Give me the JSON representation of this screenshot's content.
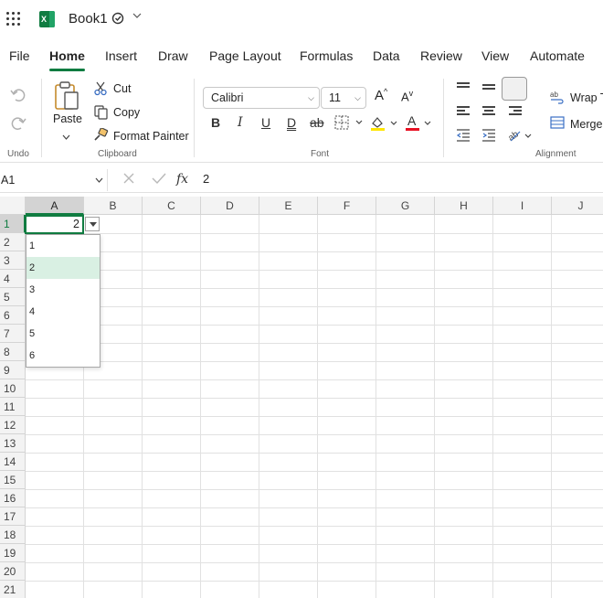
{
  "titlebar": {
    "app_logo": "X",
    "doc_title": "Book1",
    "saved_icon": "cloud-check-icon",
    "chevron_icon": "chevron-down-icon"
  },
  "tabs": [
    {
      "label": "File"
    },
    {
      "label": "Home",
      "active": true
    },
    {
      "label": "Insert"
    },
    {
      "label": "Draw"
    },
    {
      "label": "Page Layout"
    },
    {
      "label": "Formulas"
    },
    {
      "label": "Data"
    },
    {
      "label": "Review"
    },
    {
      "label": "View"
    },
    {
      "label": "Automate"
    }
  ],
  "ribbon": {
    "undo_group": {
      "label": "Undo"
    },
    "clipboard": {
      "label": "Clipboard",
      "paste": "Paste",
      "cut": "Cut",
      "copy": "Copy",
      "format_painter": "Format Painter"
    },
    "font": {
      "label": "Font",
      "font_name": "Calibri",
      "font_size": "11",
      "bold": "B",
      "italic": "I",
      "underline": "U",
      "double_underline": "D",
      "strike": "ab",
      "font_color_glyph": "A",
      "grow_glyph": "A",
      "shrink_glyph": "A"
    },
    "alignment": {
      "label": "Alignment",
      "wrap_text": "Wrap T",
      "merge": "Merge"
    }
  },
  "colors": {
    "accent": "#107c41",
    "highlight_yellow": "#ffe600",
    "font_red": "#e81123",
    "selected_item_bg": "#d9f0e3"
  },
  "formula_bar": {
    "name_box": "A1",
    "fx_label": "fx",
    "value": "2"
  },
  "grid": {
    "columns": [
      "A",
      "B",
      "C",
      "D",
      "E",
      "F",
      "G",
      "H",
      "I",
      "J"
    ],
    "rows": [
      "1",
      "2",
      "3",
      "4",
      "5",
      "6",
      "7",
      "8",
      "9",
      "10",
      "11",
      "12",
      "13",
      "14",
      "15",
      "16",
      "17",
      "18",
      "19",
      "20",
      "21"
    ],
    "active_cell_value": "2"
  },
  "dropdown": {
    "items": [
      "1",
      "2",
      "3",
      "4",
      "5",
      "6"
    ],
    "selected_index": 1
  }
}
